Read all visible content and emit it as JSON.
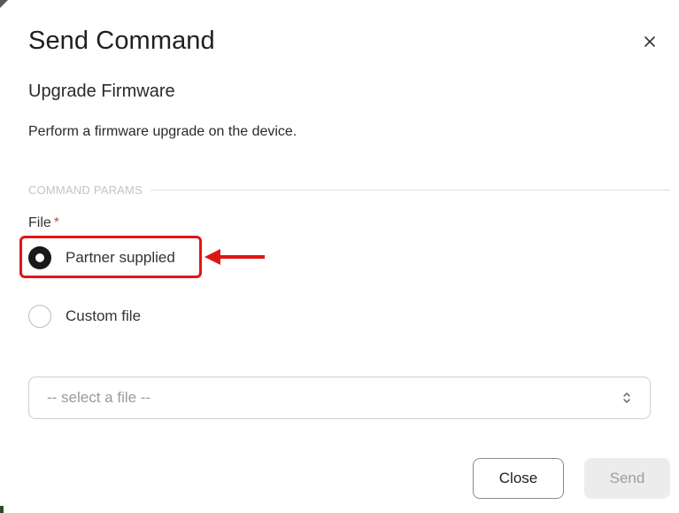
{
  "dialog": {
    "title": "Send Command",
    "close_icon": "close-icon"
  },
  "command": {
    "name": "Upgrade Firmware",
    "description": "Perform a firmware upgrade on the device."
  },
  "params_section": {
    "label": "COMMAND PARAMS"
  },
  "file_field": {
    "label": "File",
    "required_marker": "*",
    "options": [
      {
        "label": "Partner supplied",
        "selected": true
      },
      {
        "label": "Custom file",
        "selected": false
      }
    ],
    "select_placeholder": "-- select a file --"
  },
  "annotation": {
    "highlight_color": "#e01515",
    "arrow_icon": "arrow-left-icon"
  },
  "footer": {
    "close_label": "Close",
    "send_label": "Send",
    "send_disabled": true
  }
}
